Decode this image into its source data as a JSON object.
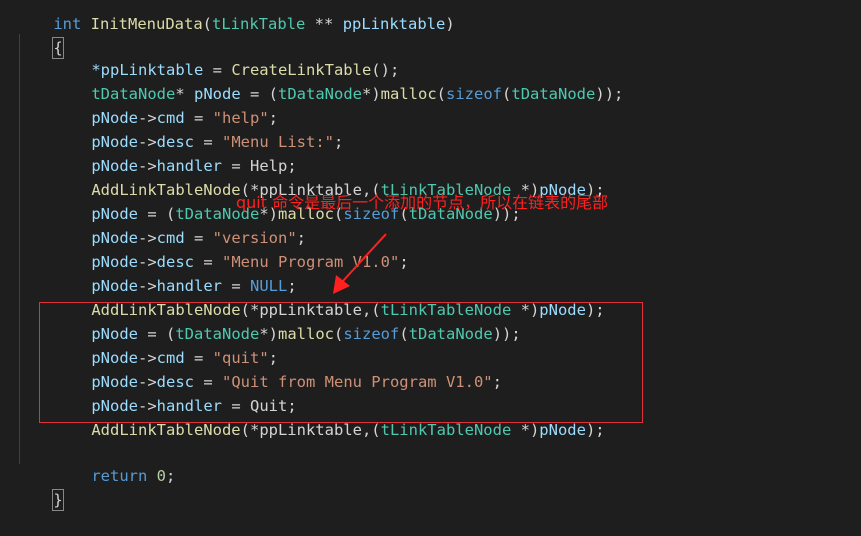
{
  "editor": {
    "signature": {
      "type": "int",
      "name": "InitMenuData",
      "paren_open": "(",
      "param_type": "tLinkTable",
      "pointer": "**",
      "param_name": "ppLinktable",
      "paren_close": ")"
    },
    "open_brace": "{",
    "close_brace": "}",
    "lines": {
      "l2": {
        "var": "*ppLinktable",
        "eq": " = ",
        "fn": "CreateLinkTable",
        "rest": "();"
      },
      "l3": {
        "type": "tDataNode",
        "star": "* ",
        "var": "pNode",
        "eq": " = (",
        "cast": "tDataNode",
        "cast_end": "*)",
        "fn": "malloc",
        "p1": "(",
        "kw": "sizeof",
        "p2": "(",
        "arg": "tDataNode",
        "end": "));"
      },
      "l4": {
        "var": "pNode",
        "arrow": "->",
        "field": "cmd",
        "eq": " = ",
        "str": "\"help\"",
        "end": ";"
      },
      "l5": {
        "var": "pNode",
        "arrow": "->",
        "field": "desc",
        "eq": " = ",
        "str": "\"Menu List:\"",
        "end": ";"
      },
      "l6": {
        "var": "pNode",
        "arrow": "->",
        "field": "handler",
        "eq": " = ",
        "val": "Help",
        "end": ";"
      },
      "l7": {
        "fn": "AddLinkTableNode",
        "p": "(*",
        "var": "ppLinktable",
        "mid": ",(",
        "type": "tLinkTableNode",
        "star": " *)",
        "var2": "pNode",
        "end": ");"
      },
      "l8": {
        "var": "pNode",
        "eq": " = (",
        "cast": "tDataNode",
        "cast_end": "*)",
        "fn": "malloc",
        "p1": "(",
        "kw": "sizeof",
        "p2": "(",
        "arg": "tDataNode",
        "end": "));"
      },
      "l9": {
        "var": "pNode",
        "arrow": "->",
        "field": "cmd",
        "eq": " = ",
        "str": "\"version\"",
        "end": ";"
      },
      "l10": {
        "var": "pNode",
        "arrow": "->",
        "field": "desc",
        "eq": " = ",
        "str": "\"Menu Program V1.0\"",
        "end": ";"
      },
      "l11": {
        "var": "pNode",
        "arrow": "->",
        "field": "handler",
        "eq": " = ",
        "kw": "NULL",
        "end": ";"
      },
      "l12": {
        "fn": "AddLinkTableNode",
        "p": "(*",
        "var": "ppLinktable",
        "mid": ",(",
        "type": "tLinkTableNode",
        "star": " *)",
        "var2": "pNode",
        "end": ");"
      },
      "l13": {
        "var": "pNode",
        "eq": " = (",
        "cast": "tDataNode",
        "cast_end": "*)",
        "fn": "malloc",
        "p1": "(",
        "kw": "sizeof",
        "p2": "(",
        "arg": "tDataNode",
        "end": "));"
      },
      "l14": {
        "var": "pNode",
        "arrow": "->",
        "field": "cmd",
        "eq": " = ",
        "str": "\"quit\"",
        "end": ";"
      },
      "l15": {
        "var": "pNode",
        "arrow": "->",
        "field": "desc",
        "eq": " = ",
        "str": "\"Quit from Menu Program V1.0\"",
        "end": ";"
      },
      "l16": {
        "var": "pNode",
        "arrow": "->",
        "field": "handler",
        "eq": " = ",
        "val": "Quit",
        "end": ";"
      },
      "l17": {
        "fn": "AddLinkTableNode",
        "p": "(*",
        "var": "ppLinktable",
        "mid": ",(",
        "type": "tLinkTableNode",
        "star": " *)",
        "var2": "pNode",
        "end": ");"
      },
      "l19": {
        "kw": "return",
        "sp": " ",
        "num": "0",
        "end": ";"
      }
    }
  },
  "annotation": {
    "text": "quit 命令是最后一个添加的节点，所以在链表的尾部",
    "color": "#ff2020"
  },
  "colors": {
    "background": "#1e1e1e",
    "keyword": "#569cd6",
    "type": "#4ec9b0",
    "variable": "#9cdcfe",
    "string": "#ce9178",
    "function": "#dcdcaa",
    "number": "#b5cea8",
    "highlight_box": "#e0303a"
  }
}
